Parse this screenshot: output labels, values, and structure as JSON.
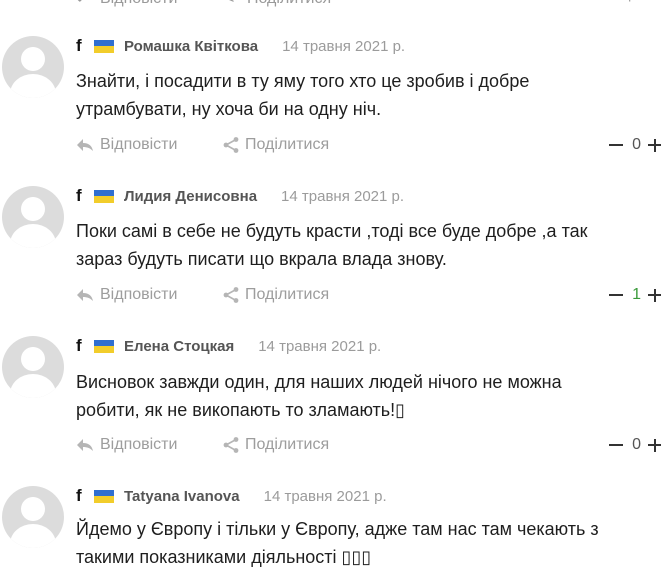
{
  "top_actions": {
    "reply": "Відповісти",
    "share": "Поділитися"
  },
  "labels": {
    "fb": "f"
  },
  "comments": [
    {
      "author": "Ромашка Квіткова",
      "date": "14 травня 2021 р.",
      "lines": [
        "Знайти,  і посадити в ту яму того хто це зробив і добре",
        "утрамбувати, ну хоча би на одну ніч."
      ],
      "reply": "Відповісти",
      "share": "Поділитися",
      "votes": "0"
    },
    {
      "author": "Лидия Денисовна",
      "date": "14 травня 2021 р.",
      "lines": [
        "Поки самі в себе не будуть красти ,тоді все буде добре ,а так",
        "зараз будуть писати що вкрала влада знову."
      ],
      "reply": "Відповісти",
      "share": "Поділитися",
      "votes": "1"
    },
    {
      "author": "Елена Стоцкая",
      "date": "14 травня 2021 р.",
      "lines": [
        "Висновок завжди один, для наших людей нічого не можна",
        "робити, як не викопають то зламають!▯"
      ],
      "reply": "Відповісти",
      "share": "Поділитися",
      "votes": "0"
    },
    {
      "author": "Tatyana Ivanova",
      "date": "14 травня 2021 р.",
      "lines": [
        "Йдемо у Європу і тільки у Європу, адже там нас там чекають з",
        "такими показниками діяльності ▯▯▯"
      ]
    }
  ],
  "colors": {
    "flag_blue": "#2f6fd1",
    "flag_yellow": "#f2cd2b",
    "muted": "#9d9d9d",
    "positive": "#3a9a3a"
  }
}
